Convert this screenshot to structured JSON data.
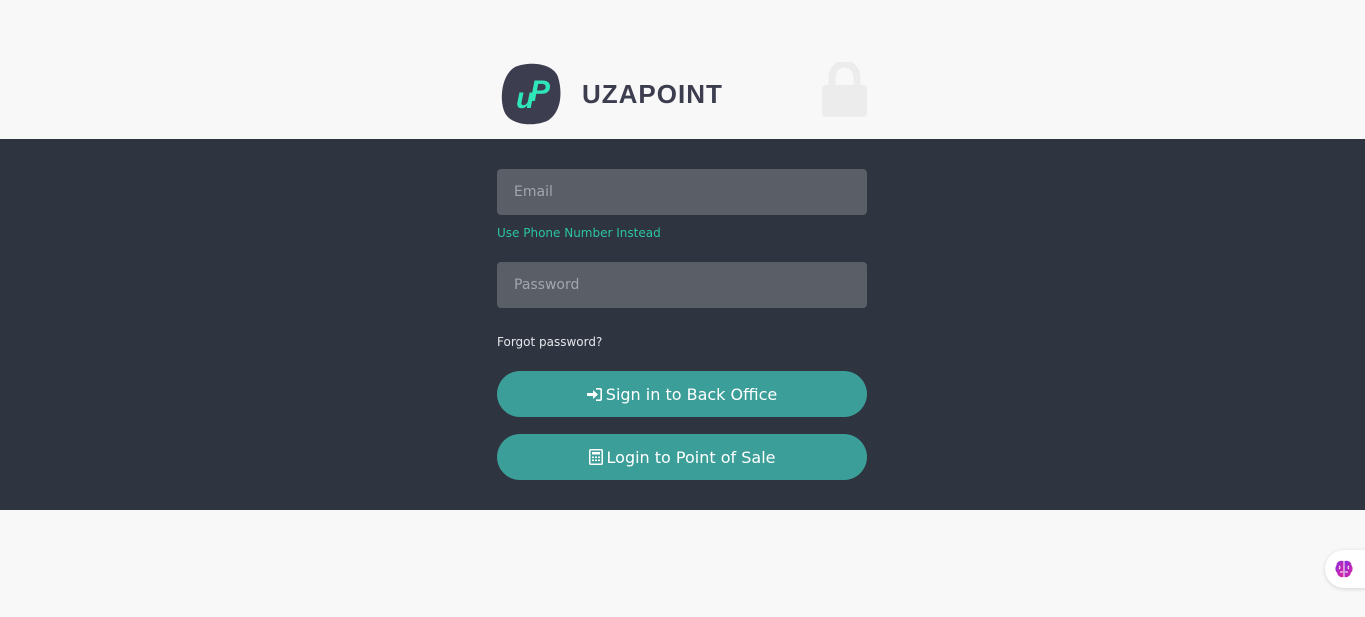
{
  "brand": {
    "name": "UZAPOINT",
    "logo_text": "uP",
    "logo_color": "#3d3d50",
    "logo_accent": "#2ee6b8",
    "lock_icon": "lock-icon"
  },
  "form": {
    "email_placeholder": "Email",
    "email_value": "",
    "phone_link": "Use Phone Number Instead",
    "password_placeholder": "Password",
    "password_value": "",
    "forgot_link": "Forgot password?"
  },
  "buttons": {
    "backoffice_label": "Sign in to Back Office",
    "backoffice_icon": "sign-in-icon",
    "pos_label": "Login to Point of Sale",
    "pos_icon": "calculator-icon"
  },
  "widget": {
    "icon": "brain-icon"
  },
  "colors": {
    "band": "#2e3440",
    "button": "#3b9e98",
    "link_accent": "#2bc4a4",
    "page_bg": "#f8f8f8"
  }
}
